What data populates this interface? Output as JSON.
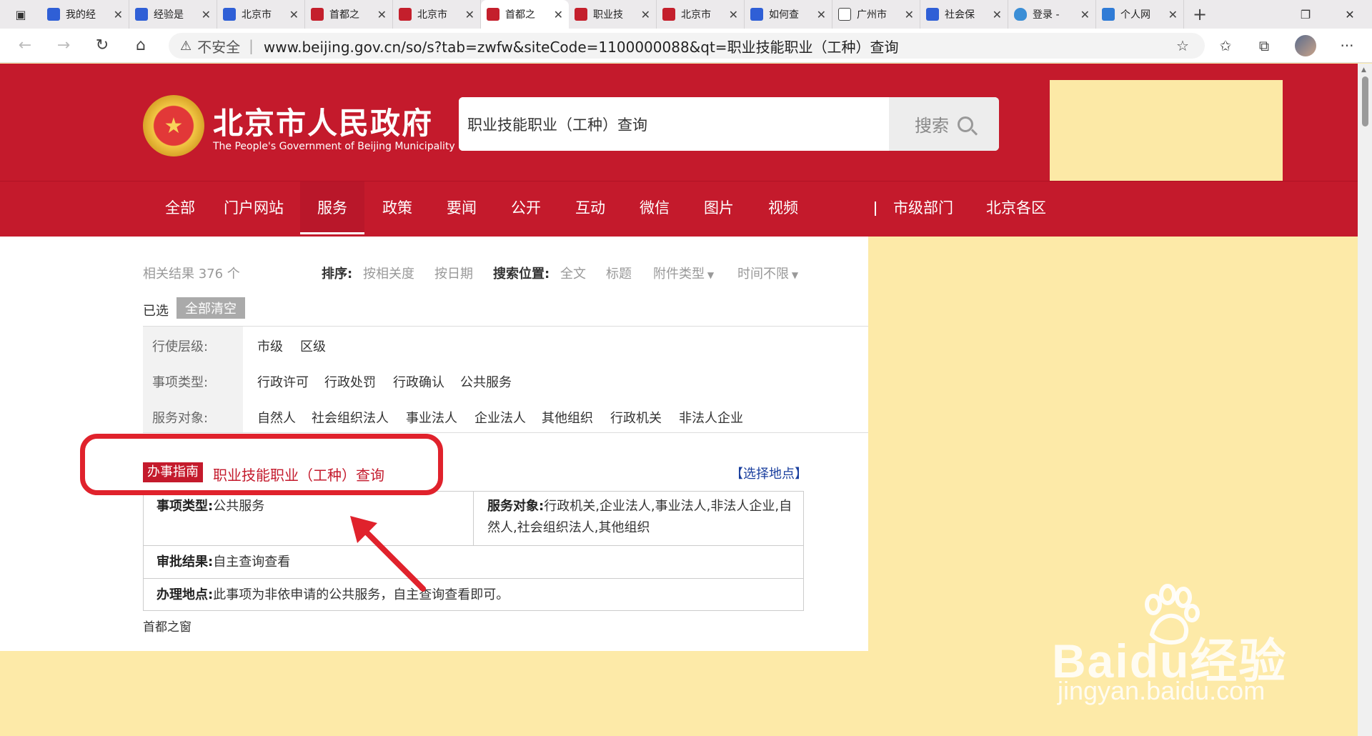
{
  "browser": {
    "tabs": [
      {
        "label": "我的经",
        "icon": "paw"
      },
      {
        "label": "经验是",
        "icon": "paw"
      },
      {
        "label": "北京市",
        "icon": "paw"
      },
      {
        "label": "首都之",
        "icon": "gov"
      },
      {
        "label": "北京市",
        "icon": "gov"
      },
      {
        "label": "首都之",
        "icon": "gov",
        "active": true
      },
      {
        "label": "职业技",
        "icon": "gov"
      },
      {
        "label": "北京市",
        "icon": "gov"
      },
      {
        "label": "如何查",
        "icon": "paw"
      },
      {
        "label": "广州市",
        "icon": "doc"
      },
      {
        "label": "社会保",
        "icon": "paw"
      },
      {
        "label": "登录 -",
        "icon": "shield"
      },
      {
        "label": "个人网",
        "icon": "id"
      }
    ],
    "address": {
      "insecure_label": "不安全",
      "url": "www.beijing.gov.cn/so/s?tab=zwfw&siteCode=1100000088&qt=职业技能职业（工种）查询"
    }
  },
  "header": {
    "title": "北京市人民政府",
    "subtitle": "The People's Government of Beijing Municipality",
    "search_value": "职业技能职业（工种）查询",
    "search_button": "搜索"
  },
  "nav": {
    "items": [
      "全部",
      "门户网站",
      "服务",
      "政策",
      "要闻",
      "公开",
      "互动",
      "微信",
      "图片",
      "视频"
    ],
    "active": "服务",
    "right_items": [
      "市级部门",
      "北京各区"
    ]
  },
  "results": {
    "count_text": "相关结果 376 个",
    "sort_label": "排序:",
    "sort_options": [
      "按相关度",
      "按日期"
    ],
    "position_label": "搜索位置:",
    "position_options": [
      "全文",
      "标题"
    ],
    "attachment_type": "附件类型",
    "time_limit": "时间不限",
    "selected_label": "已选",
    "clear_all": "全部清空"
  },
  "filters": {
    "level_label": "行使层级:",
    "level_options": [
      "市级",
      "区级"
    ],
    "type_label": "事项类型:",
    "type_options": [
      "行政许可",
      "行政处罚",
      "行政确认",
      "公共服务"
    ],
    "target_label": "服务对象:",
    "target_options": [
      "自然人",
      "社会组织法人",
      "事业法人",
      "企业法人",
      "其他组织",
      "行政机关",
      "非法人企业"
    ]
  },
  "result_item": {
    "tag": "办事指南",
    "title": "职业技能职业（工种）查询",
    "choose_location": "【选择地点】",
    "type_label": "事项类型:",
    "type_value": "公共服务",
    "target_label": "服务对象:",
    "target_value_line1": "行政机关,企业法人,事业法人,非法人企业,自",
    "target_value_line2": "然人,社会组织法人,其他组织",
    "approval_label": "审批结果:",
    "approval_value": "自主查询查看",
    "location_label": "办理地点:",
    "location_value": "此事项为非依申请的公共服务，自主查询查看即可。",
    "source": "首都之窗"
  },
  "watermark": {
    "main": "Baidu经验",
    "sub": "jingyan.baidu.com"
  },
  "colors": {
    "brand_red": "#c41a2c",
    "highlight_outline": "#e0222c",
    "link_blue": "#1a3f9e",
    "background_yellow": "#fdeaa8"
  }
}
